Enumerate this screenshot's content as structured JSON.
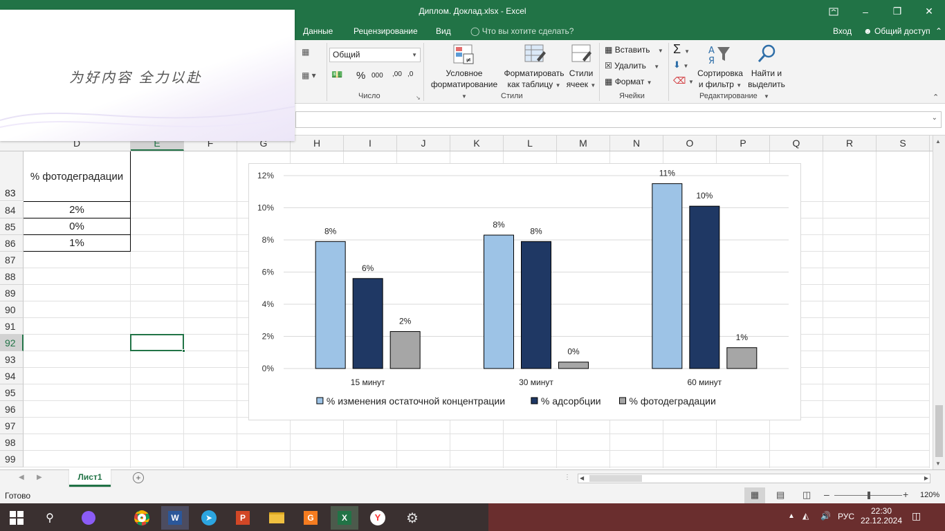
{
  "window": {
    "title": "Диплом. Доклад.xlsx - Excel"
  },
  "tabs": [
    "Данные",
    "Рецензирование",
    "Вид"
  ],
  "tell_me": "Что вы хотите сделать?",
  "account": {
    "signin": "Вход",
    "share": "Общий доступ"
  },
  "ribbon": {
    "number_format": "Общий",
    "groups": {
      "number": "Число",
      "styles": "Стили",
      "cells": "Ячейки",
      "editing": "Редактирование"
    },
    "styles": {
      "cond_line1": "Условное",
      "cond_line2": "форматирование",
      "table_line1": "Форматировать",
      "table_line2": "как таблицу",
      "cell_line1": "Стили",
      "cell_line2": "ячеек"
    },
    "cells": {
      "insert": "Вставить",
      "delete": "Удалить",
      "format": "Формат"
    },
    "editing": {
      "sort_line1": "Сортировка",
      "sort_line2": "и фильтр",
      "find_line1": "Найти и",
      "find_line2": "выделить"
    }
  },
  "popup": {
    "text": "为好内容 全力以赴"
  },
  "columns": [
    "D",
    "E",
    "F",
    "G",
    "H",
    "I",
    "J",
    "K",
    "L",
    "M",
    "N",
    "O",
    "P",
    "Q",
    "R",
    "S"
  ],
  "rows": [
    "83",
    "84",
    "85",
    "86",
    "87",
    "88",
    "89",
    "90",
    "91",
    "92",
    "93",
    "94",
    "95",
    "96",
    "97",
    "98",
    "99"
  ],
  "cells": {
    "header": "% фотодеградации",
    "values": [
      "2%",
      "0%",
      "1%"
    ]
  },
  "chart_data": {
    "type": "bar",
    "categories": [
      "15 минут",
      "30 минут",
      "60 минут"
    ],
    "series": [
      {
        "name": "% изменения остаточной концентрации",
        "values": [
          0.079,
          0.083,
          0.115
        ],
        "labels": [
          "8%",
          "8%",
          "11%"
        ],
        "color": "#9dc3e6"
      },
      {
        "name": "% адсорбции",
        "values": [
          0.056,
          0.079,
          0.101
        ],
        "labels": [
          "6%",
          "8%",
          "10%"
        ],
        "color": "#1f3864"
      },
      {
        "name": "% фотодеградации",
        "values": [
          0.023,
          0.004,
          0.013
        ],
        "labels": [
          "2%",
          "0%",
          "1%"
        ],
        "color": "#a6a6a6"
      }
    ],
    "ylim": [
      0,
      0.12
    ],
    "yticks": [
      "0%",
      "2%",
      "4%",
      "6%",
      "8%",
      "10%",
      "12%"
    ],
    "grid": true,
    "legend": "bottom"
  },
  "sheet": {
    "name": "Лист1"
  },
  "status": {
    "ready": "Готово",
    "zoom": "120%"
  },
  "taskbar": {
    "lang": "РУС",
    "time": "22:30",
    "date": "22.12.2024"
  },
  "colors": {
    "excel_green": "#217346",
    "taskbar": "#6a2e2e"
  }
}
